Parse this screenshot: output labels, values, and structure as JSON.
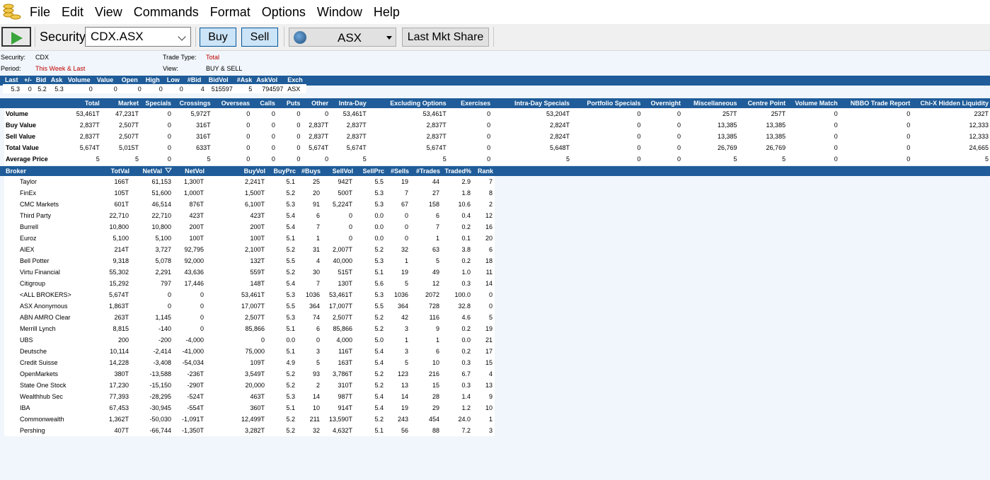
{
  "menu": [
    "File",
    "Edit",
    "View",
    "Commands",
    "Format",
    "Options",
    "Window",
    "Help"
  ],
  "toolbar": {
    "security_label": "Security:",
    "security_value": "CDX.ASX",
    "buy_label": "Buy",
    "sell_label": "Sell",
    "exchange_value": "ASX",
    "last_mkt_share_label": "Last Mkt Share"
  },
  "info": {
    "security_label": "Security:",
    "security_value": "CDX",
    "period_label": "Period:",
    "period_value": "This Week & Last",
    "trade_type_label": "Trade Type:",
    "trade_type_value": "Total",
    "view_label": "View:",
    "view_value": "BUY & SELL"
  },
  "quote": {
    "headers": [
      "Last",
      "+/-",
      "Bid",
      "Ask",
      "Volume",
      "Value",
      "Open",
      "High",
      "Low",
      "#Bid",
      "BidVol",
      "#Ask",
      "AskVol",
      "Exch"
    ],
    "values": [
      "5.3",
      "0",
      "5.2",
      "5.3",
      "0",
      "0",
      "0",
      "0",
      "0",
      "4",
      "515597",
      "5",
      "794597",
      "ASX"
    ]
  },
  "summary": {
    "headers": [
      "",
      "Total",
      "Market",
      "Specials",
      "Crossings",
      "Overseas",
      "Calls",
      "Puts",
      "Other",
      "Intra-Day",
      "Excluding Options",
      "Exercises",
      "Intra-Day Specials",
      "Portfolio Specials",
      "Overnight",
      "Miscellaneous",
      "Centre Point",
      "Volume Match",
      "NBBO Trade Report",
      "Chi-X Hidden Liquidity"
    ],
    "rows": [
      [
        "Volume",
        "53,461T",
        "47,231T",
        "0",
        "5,972T",
        "0",
        "0",
        "0",
        "0",
        "53,461T",
        "53,461T",
        "0",
        "53,204T",
        "0",
        "0",
        "257T",
        "257T",
        "0",
        "0",
        "232T"
      ],
      [
        "Buy Value",
        "2,837T",
        "2,507T",
        "0",
        "316T",
        "0",
        "0",
        "0",
        "2,837T",
        "2,837T",
        "2,837T",
        "0",
        "2,824T",
        "0",
        "0",
        "13,385",
        "13,385",
        "0",
        "0",
        "12,333"
      ],
      [
        "Sell Value",
        "2,837T",
        "2,507T",
        "0",
        "316T",
        "0",
        "0",
        "0",
        "2,837T",
        "2,837T",
        "2,837T",
        "0",
        "2,824T",
        "0",
        "0",
        "13,385",
        "13,385",
        "0",
        "0",
        "12,333"
      ],
      [
        "Total Value",
        "5,674T",
        "5,015T",
        "0",
        "633T",
        "0",
        "0",
        "0",
        "5,674T",
        "5,674T",
        "5,674T",
        "0",
        "5,648T",
        "0",
        "0",
        "26,769",
        "26,769",
        "0",
        "0",
        "24,665"
      ],
      [
        "Average Price",
        "5",
        "5",
        "0",
        "5",
        "0",
        "0",
        "0",
        "0",
        "5",
        "5",
        "0",
        "5",
        "0",
        "0",
        "5",
        "5",
        "0",
        "0",
        "5"
      ]
    ]
  },
  "broker": {
    "headers": [
      "Broker",
      "TotVal",
      "NetVal",
      "",
      "NetVol",
      "BuyVol",
      "BuyPrc",
      "#Buys",
      "SellVol",
      "SellPrc",
      "#Sells",
      "#Trades",
      "Traded%",
      "Rank"
    ],
    "rows": [
      [
        "Taylor",
        "166T",
        "61,153",
        "1,300T",
        "2,241T",
        "5.1",
        "25",
        "942T",
        "5.5",
        "19",
        "44",
        "2.9",
        "7"
      ],
      [
        "FinEx",
        "105T",
        "51,600",
        "1,000T",
        "1,500T",
        "5.2",
        "20",
        "500T",
        "5.3",
        "7",
        "27",
        "1.8",
        "8"
      ],
      [
        "CMC Markets",
        "601T",
        "46,514",
        "876T",
        "6,100T",
        "5.3",
        "91",
        "5,224T",
        "5.3",
        "67",
        "158",
        "10.6",
        "2"
      ],
      [
        "Third Party",
        "22,710",
        "22,710",
        "423T",
        "423T",
        "5.4",
        "6",
        "0",
        "0.0",
        "0",
        "6",
        "0.4",
        "12"
      ],
      [
        "Burrell",
        "10,800",
        "10,800",
        "200T",
        "200T",
        "5.4",
        "7",
        "0",
        "0.0",
        "0",
        "7",
        "0.2",
        "16"
      ],
      [
        "Euroz",
        "5,100",
        "5,100",
        "100T",
        "100T",
        "5.1",
        "1",
        "0",
        "0.0",
        "0",
        "1",
        "0.1",
        "20"
      ],
      [
        "AIEX",
        "214T",
        "3,727",
        "92,795",
        "2,100T",
        "5.2",
        "31",
        "2,007T",
        "5.2",
        "32",
        "63",
        "3.8",
        "6"
      ],
      [
        "Bell Potter",
        "9,318",
        "5,078",
        "92,000",
        "132T",
        "5.5",
        "4",
        "40,000",
        "5.3",
        "1",
        "5",
        "0.2",
        "18"
      ],
      [
        "Virtu Financial",
        "55,302",
        "2,291",
        "43,636",
        "559T",
        "5.2",
        "30",
        "515T",
        "5.1",
        "19",
        "49",
        "1.0",
        "11"
      ],
      [
        "Citigroup",
        "15,292",
        "797",
        "17,446",
        "148T",
        "5.4",
        "7",
        "130T",
        "5.6",
        "5",
        "12",
        "0.3",
        "14"
      ],
      [
        "<ALL BROKERS>",
        "5,674T",
        "0",
        "0",
        "53,461T",
        "5.3",
        "1036",
        "53,461T",
        "5.3",
        "1036",
        "2072",
        "100.0",
        "0"
      ],
      [
        "ASX Anonymous",
        "1,863T",
        "0",
        "0",
        "17,007T",
        "5.5",
        "364",
        "17,007T",
        "5.5",
        "364",
        "728",
        "32.8",
        "0"
      ],
      [
        "ABN AMRO Clear",
        "263T",
        "1,145",
        "0",
        "2,507T",
        "5.3",
        "74",
        "2,507T",
        "5.2",
        "42",
        "116",
        "4.6",
        "5"
      ],
      [
        "Merrill Lynch",
        "8,815",
        "-140",
        "0",
        "85,866",
        "5.1",
        "6",
        "85,866",
        "5.2",
        "3",
        "9",
        "0.2",
        "19"
      ],
      [
        "UBS",
        "200",
        "-200",
        "-4,000",
        "0",
        "0.0",
        "0",
        "4,000",
        "5.0",
        "1",
        "1",
        "0.0",
        "21"
      ],
      [
        "Deutsche",
        "10,114",
        "-2,414",
        "-41,000",
        "75,000",
        "5.1",
        "3",
        "116T",
        "5.4",
        "3",
        "6",
        "0.2",
        "17"
      ],
      [
        "Credit Suisse",
        "14,228",
        "-3,408",
        "-54,034",
        "109T",
        "4.9",
        "5",
        "163T",
        "5.4",
        "5",
        "10",
        "0.3",
        "15"
      ],
      [
        "OpenMarkets",
        "380T",
        "-13,588",
        "-236T",
        "3,549T",
        "5.2",
        "93",
        "3,786T",
        "5.2",
        "123",
        "216",
        "6.7",
        "4"
      ],
      [
        "State One Stock",
        "17,230",
        "-15,150",
        "-290T",
        "20,000",
        "5.2",
        "2",
        "310T",
        "5.2",
        "13",
        "15",
        "0.3",
        "13"
      ],
      [
        "Wealthhub Sec",
        "77,393",
        "-28,295",
        "-524T",
        "463T",
        "5.3",
        "14",
        "987T",
        "5.4",
        "14",
        "28",
        "1.4",
        "9"
      ],
      [
        "IBA",
        "67,453",
        "-30,945",
        "-554T",
        "360T",
        "5.1",
        "10",
        "914T",
        "5.4",
        "19",
        "29",
        "1.2",
        "10"
      ],
      [
        "Commonwealth",
        "1,362T",
        "-50,030",
        "-1,091T",
        "12,499T",
        "5.2",
        "211",
        "13,590T",
        "5.2",
        "243",
        "454",
        "24.0",
        "1"
      ],
      [
        "Pershing",
        "407T",
        "-66,744",
        "-1,350T",
        "3,282T",
        "5.2",
        "32",
        "4,632T",
        "5.1",
        "56",
        "88",
        "7.2",
        "3"
      ]
    ]
  }
}
